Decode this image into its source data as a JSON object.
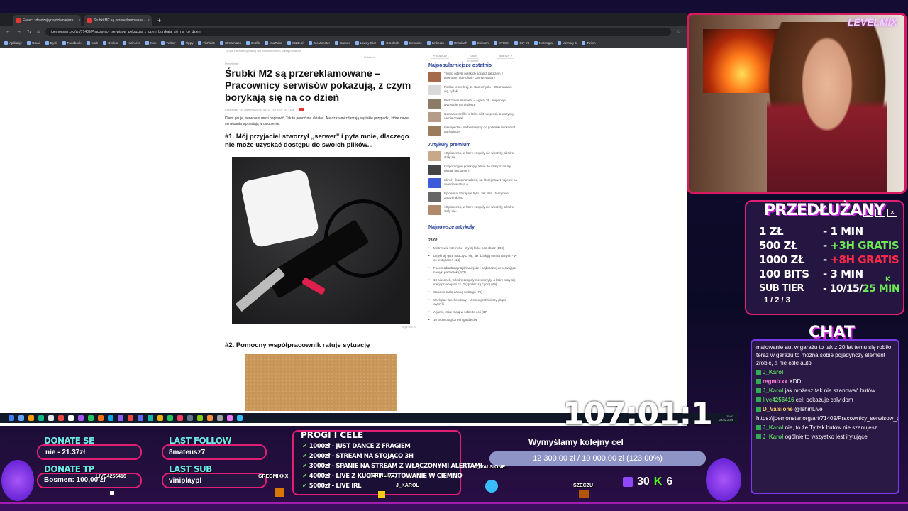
{
  "browser": {
    "tabs": [
      {
        "label": "Faceci zdradzają najdziwniejsze..."
      },
      {
        "label": "Śrubki M2 są przereklamowane -"
      }
    ],
    "new_tab": "+",
    "url": "joemonster.org/art/71409/Pracownicy_serwisow_pokazuja_z_czym_borykaja_sie_na_co_dzien",
    "bookmarks": [
      "Aplikacje",
      "Gmail",
      "Dysk",
      "Facebook",
      "work",
      "Oculus",
      "IshinLive",
      "Kick",
      "Twitter",
      "Tippy",
      "TikFinity",
      "Streamlabs",
      "Grafik",
      "YouTube",
      "JBZD.pl",
      "JoeMonster",
      "Games",
      "Łowcy Gier",
      "GG.deals",
      "Behance",
      "LinkedIn",
      "Unsplash",
      "Skinden",
      "STOCK",
      "Gry tnt",
      "Norwegia",
      "Memory 5",
      "Twitch"
    ]
  },
  "article": {
    "topnav": "Grupa FB   Kolekcje   Blog   Top   Archiwum   RSS   Wersja mobilna",
    "category": "Reklama",
    "breadcrumb": "Przyziemie",
    "headline": "Śrubki M2 są przereklamowane – Pracownicy serwisów pokazują, z czym borykają się na co dzień",
    "meta": "Kordowski · 11 kwietnia 2024, 08:02 · 65 640 · 89 · 108",
    "lead": "Klient psuje, serwisant musi naprawić. Tak to ponoć ma działać. Ale czasami zdarzają się takie przypadki, które nawet serwisanta wprawiają w osłupienie.",
    "h1": "#1. Mój przyjaciel stworzył „serwer\" i pyta mnie, dlaczego nie może uzyskać dostępu do swoich plików...",
    "credit": "Imgur.com #1",
    "h2": "#2. Pomocny współpracownik ratuje sytuację"
  },
  "sidebar": {
    "tabs": [
      "« nowszy",
      "losuj",
      "starszy »"
    ],
    "tabs_note": "Reklama",
    "recent_title": "Najpopularniejsze ostatnio",
    "recent": [
      "Trump odsyła polskich górali z zakazem z powrotem do Polski - Demotywatory",
      "Polska to nie kraj, to stan umysłu – Opanowanie się, tydaki",
      "Mistrzowie Internetu – Agata, 38, proponuje wyzwanie na Tinderze",
      "Odważne selfiki, o które nikt nie prosił, a wszyscy na nie czekali",
      "Faktopedia - Najbudniejszy do podróbki bankomat na Świecie"
    ],
    "premium_title": "Artykuły premium",
    "premium": [
      "10 piosenek, w które zespoły nie wierzyły, a które stały się...",
      "Korporacyjne przekręty, które do dziś pozostały niemal bezkarne II",
      "Sknel – baza narodowa, na której nawet najlepsi na świecie wlatują o",
      "Epidemia, której nie było. Jak 1HIL, fascynuje zarazie dzieci",
      "10 piosenek, w które zespoły nie wierzyły, a które stały się..."
    ],
    "newest_title": "Najnowsze artykuły",
    "newest_date": "28.02",
    "newest": [
      "Mistrzowie internetu - Wyślij fotkę bez obraz (106)",
      "Dzięki tej grze nauczysz się, jak działają centra danych - W co jest grane? (14)",
      "Faceci zdradzają najdziwniejsze i najbardziej denerwujące nawyki partnerek (103)",
      "10 piosenek, w które zespoły nie wierzyły, a które stały się megaprzebojami cz. 2 (spoiler: są cycki) (49)",
      "Czas na małą dawkę nostalgii (71)",
      "Wielopak Weekendowy - Uroczo groźniki czy głupie wybryki",
      "Arjanki, które mają w sobie to coś (37)",
      "10 technologicznych gadżetów"
    ]
  },
  "taskbar": {
    "time": "15:07",
    "date": "28.02.2026"
  },
  "webcam": {
    "logo": "LEVELMIX"
  },
  "subathon": {
    "title": "PRZEDŁUŻANY",
    "rows": [
      {
        "amount": "1 ZŁ",
        "time": "- 1 MIN",
        "bonus": ""
      },
      {
        "amount": "500 ZŁ",
        "time": "- ",
        "bonus": "+3H GRATIS"
      },
      {
        "amount": "1000 ZŁ",
        "time": "- ",
        "bonus": "+8H GRATIS"
      },
      {
        "amount": "100 BITS",
        "time": "- 3 MIN",
        "bonus": ""
      },
      {
        "amount": "SUB TIER",
        "time": "- 10/15/",
        "bonus": "25 MIN"
      }
    ],
    "tiers": "1 / 2 / 3",
    "tier_k": "K",
    "btn_min": "_",
    "btn_max": "□",
    "btn_close": "✕"
  },
  "chat": {
    "title": "CHAT",
    "messages": [
      {
        "user": "",
        "text": "malowanie aut w garażu to tak z 20 lat temu się robiło, teraz w garażu to można sobie pojedynczy element zrobić, a nie całe auto"
      },
      {
        "user": "J_Karol",
        "text": ""
      },
      {
        "user": "regmixxx",
        "text": "XDD"
      },
      {
        "user": "J_Karol",
        "text": "jak możesz tak nie szanować butów"
      },
      {
        "user": "live4256416",
        "text": "cel: pokazuje cały dom"
      },
      {
        "user": "D_Valsione",
        "text": "@IshinLive"
      },
      {
        "user": "",
        "text": "https://joemonster.org/art/71409/Pracownicy_serwisow_pokazuja_z_czym_borykaja_sie_na_co_dzien"
      },
      {
        "user": "J_Karol",
        "text": "nie, to że Ty tak butów nie szanujesz"
      },
      {
        "user": "J_Karol",
        "text": "ogólnie to wszystko jest irytujące"
      }
    ]
  },
  "overlay": {
    "donate_se_label": "DONATE SE",
    "donate_se_value": "nie - 21.37zł",
    "donate_tp_label": "DONATE TP",
    "donate_tp_value": "Bosmen: 100,00 zł",
    "last_follow_label": "LAST FOLLOW",
    "last_follow_value": "8mateusz7",
    "last_sub_label": "LAST SUB",
    "last_sub_value": "viniplaypl",
    "goals_title": "PROGI I CELE",
    "goals": [
      "1000zł - JUST DANCE Z FRAGIEM",
      "2000zł - STREAM NA STOJĄCO 3H",
      "3000zł - SPANIE NA STREAM Z WŁĄCZONYMI ALERTAMI",
      "4000zł - LIVE Z KUCHNI - GOTOWANIE W CIEMNO",
      "5000zł - LIVE IRL"
    ],
    "target_title": "Wymyślamy kolejny cel",
    "target_progress": "12 300,00 zł / 10 000,00 zł (123.00%)",
    "target_fraction": 1.0,
    "timer": "107:01:1",
    "viewers_twitch": "30",
    "viewers_kick": "6",
    "kick_icon": "K",
    "names": [
      "LIVE4256416",
      "GREGMIXXX",
      "IISHINLIVE",
      "J_KAROL",
      "D_VALSIONE",
      "SZECZU"
    ]
  }
}
